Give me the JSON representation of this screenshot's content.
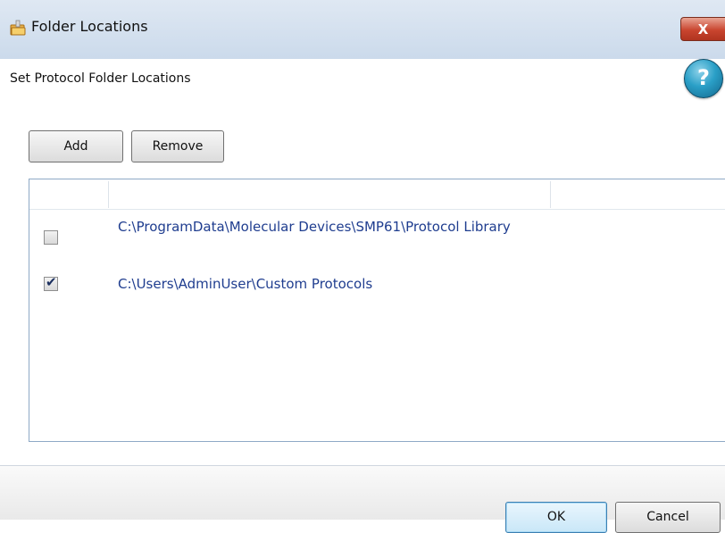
{
  "window": {
    "title": "Folder Locations",
    "close_glyph": "X",
    "icon": "folder-icon"
  },
  "dialog": {
    "subtitle": "Set Protocol Folder Locations",
    "help_glyph": "?"
  },
  "toolbar": {
    "add_label": "Add",
    "remove_label": "Remove"
  },
  "folders": [
    {
      "checked": false,
      "path": "C:\\ProgramData\\Molecular Devices\\SMP61\\Protocol Library"
    },
    {
      "checked": true,
      "path": "C:\\Users\\AdminUser\\Custom Protocols"
    }
  ],
  "footer": {
    "ok_label": "OK",
    "cancel_label": "Cancel"
  },
  "colors": {
    "path_text": "#1f3d8f",
    "titlebar": "#cbdaeb",
    "close_button": "#c9452f",
    "help_icon": "#2a9fc7"
  }
}
